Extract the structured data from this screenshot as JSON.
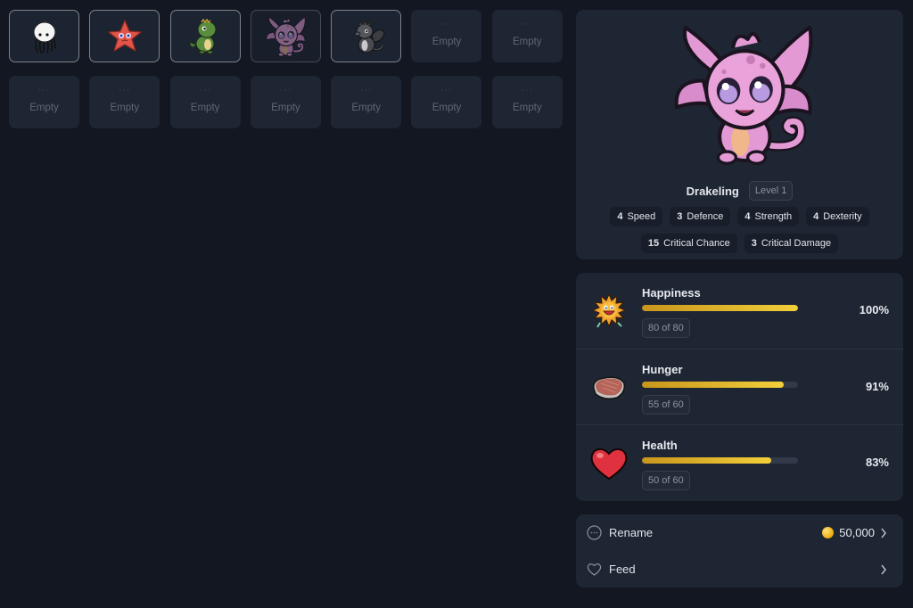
{
  "inventory": {
    "slots": [
      {
        "state": "filled",
        "pet": "jellyfish",
        "icon": "jellyfish-pet-icon"
      },
      {
        "state": "filled",
        "pet": "starfish",
        "icon": "starfish-pet-icon"
      },
      {
        "state": "filled",
        "pet": "green-dino",
        "icon": "green-dino-pet-icon"
      },
      {
        "state": "selected",
        "pet": "drakeling",
        "icon": "drakeling-pet-icon"
      },
      {
        "state": "filled",
        "pet": "black-dragon",
        "icon": "black-dragon-pet-icon"
      },
      {
        "state": "empty",
        "dots": "···",
        "label": "Empty"
      },
      {
        "state": "empty",
        "dots": "···",
        "label": "Empty"
      },
      {
        "state": "empty",
        "dots": "···",
        "label": "Empty"
      },
      {
        "state": "empty",
        "dots": "···",
        "label": "Empty"
      },
      {
        "state": "empty",
        "dots": "···",
        "label": "Empty"
      },
      {
        "state": "empty",
        "dots": "···",
        "label": "Empty"
      },
      {
        "state": "empty",
        "dots": "···",
        "label": "Empty"
      },
      {
        "state": "empty",
        "dots": "···",
        "label": "Empty"
      },
      {
        "state": "empty",
        "dots": "···",
        "label": "Empty"
      }
    ]
  },
  "pet": {
    "name": "Drakeling",
    "level": "Level 1",
    "stats_row1": [
      {
        "value": "4",
        "label": "Speed"
      },
      {
        "value": "3",
        "label": "Defence"
      },
      {
        "value": "4",
        "label": "Strength"
      },
      {
        "value": "4",
        "label": "Dexterity"
      }
    ],
    "stats_row2": [
      {
        "value": "15",
        "label": "Critical Chance"
      },
      {
        "value": "3",
        "label": "Critical Damage"
      }
    ]
  },
  "needs": [
    {
      "label": "Happiness",
      "count": "80 of 80",
      "percent": "100%",
      "fraction": 1.0,
      "icon": "happy-sun-icon"
    },
    {
      "label": "Hunger",
      "count": "55 of 60",
      "percent": "91%",
      "fraction": 0.91,
      "icon": "steak-icon"
    },
    {
      "label": "Health",
      "count": "50 of 60",
      "percent": "83%",
      "fraction": 0.83,
      "icon": "heart-icon"
    }
  ],
  "actions": {
    "rename": {
      "label": "Rename",
      "cost": "50,000"
    },
    "feed": {
      "label": "Feed"
    }
  },
  "colors": {
    "bar_fill_start": "#c9961c",
    "bar_fill_end": "#f2cf3a",
    "background": "#121722",
    "card": "#1f2633"
  }
}
